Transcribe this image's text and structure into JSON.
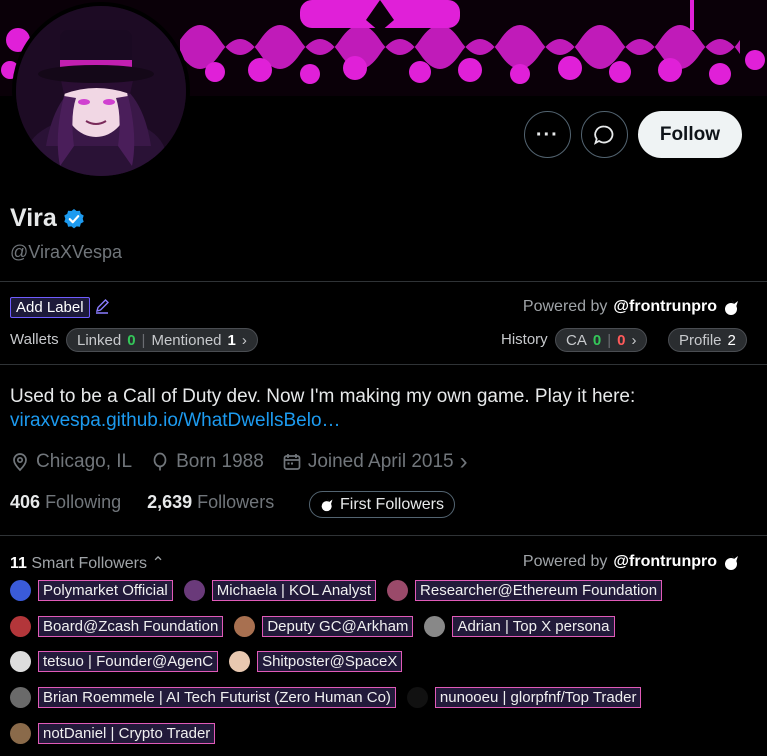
{
  "profile": {
    "name": "Vira",
    "handle": "@ViraXVespa",
    "bio": "Used to be a Call of Duty dev. Now I'm making my own game. Play it here:",
    "link": "viraxvespa.github.io/WhatDwellsBelo…",
    "location": "Chicago, IL",
    "born": "Born 1988",
    "joined": "Joined April 2015",
    "following_count": "406",
    "following_label": "Following",
    "followers_count": "2,639",
    "followers_label": "Followers"
  },
  "actions": {
    "more_icon": "more-icon",
    "message_icon": "message-icon",
    "follow_label": "Follow"
  },
  "frontrun": {
    "add_label": "Add Label",
    "powered_by": "Powered by",
    "brand": "@frontrunpro",
    "wallets_label": "Wallets",
    "linked_label": "Linked",
    "linked_count": "0",
    "mentioned_label": "Mentioned",
    "mentioned_count": "1",
    "history_label": "History",
    "ca_label": "CA",
    "ca_green": "0",
    "ca_red": "0",
    "profile_label": "Profile",
    "profile_count": "2",
    "first_followers_label": "First Followers"
  },
  "smart_followers": {
    "count": "11",
    "label": "Smart Followers",
    "powered_by": "Powered by",
    "brand": "@frontrunpro",
    "items": [
      "Polymarket Official",
      "Michaela | KOL Analyst",
      "Researcher@Ethereum Foundation",
      "Board@Zcash Foundation",
      "Deputy GC@Arkham",
      "Adrian | Top X persona",
      "tetsuo | Founder@AgenC",
      "Shitposter@SpaceX",
      "Brian Roemmele | AI Tech Futurist (Zero Human Co)",
      "nunooeu | glorpfnf/Top Trader",
      "notDaniel | Crypto Trader"
    ]
  },
  "colors": {
    "accent_blue": "#1d9bf0",
    "banner_magenta": "#e020d8",
    "tag_border": "#e05ab8",
    "green": "#34c759",
    "red": "#ff5a5a"
  }
}
